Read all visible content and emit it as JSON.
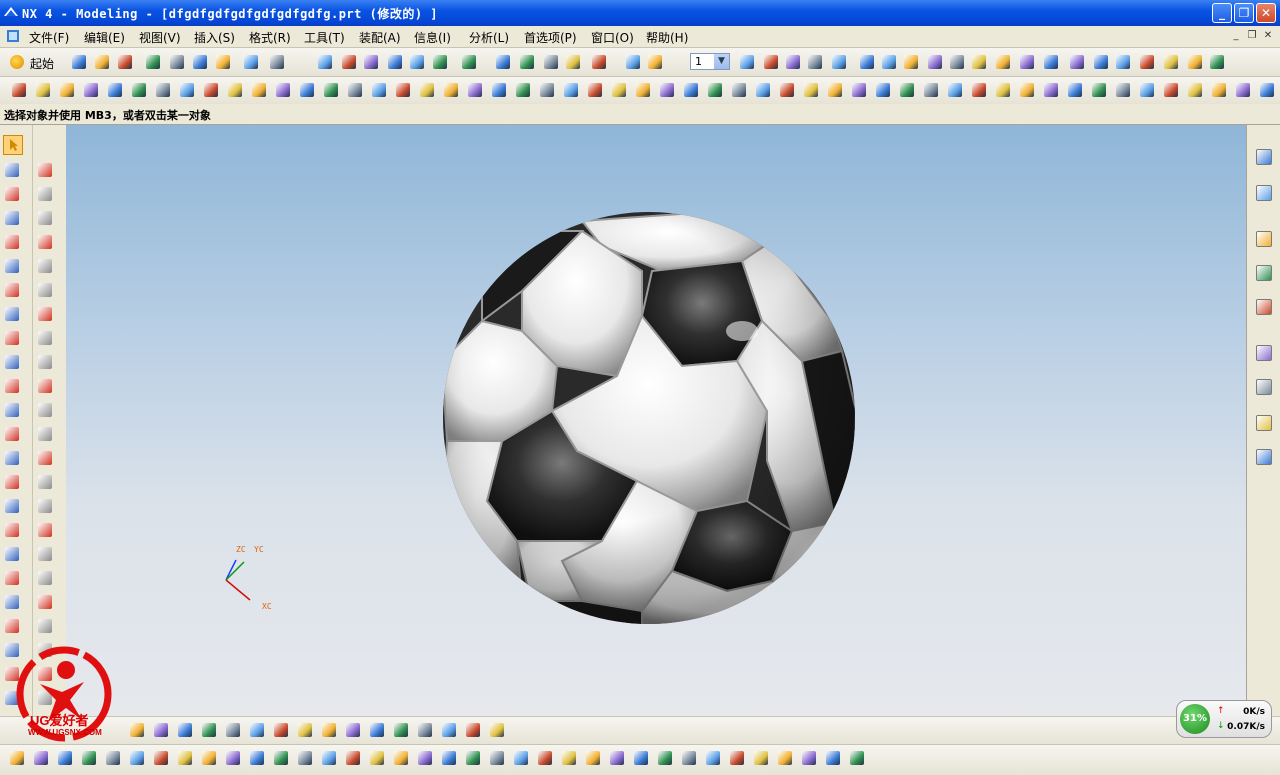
{
  "window": {
    "title": "NX 4 - Modeling - [dfgdfgdfgdfgdfgdfgdfg.prt  (修改的) ]",
    "controls": {
      "minimize": "_",
      "maximize": "❐",
      "close": "✕"
    }
  },
  "menu": {
    "items": [
      "文件(F)",
      "编辑(E)",
      "视图(V)",
      "插入(S)",
      "格式(R)",
      "工具(T)",
      "装配(A)",
      "信息(I)",
      "分析(L)",
      "首选项(P)",
      "窗口(O)",
      "帮助(H)"
    ],
    "doc_controls": {
      "minimize": "_",
      "restore": "❐",
      "close": "✕"
    }
  },
  "toolbar": {
    "start_label": "起始",
    "layer_value": "1"
  },
  "status": {
    "prompt": "选择对象并使用 MB3，或者双击某一对象"
  },
  "viewport": {
    "triad_labels": {
      "zc": "ZC",
      "yc": "YC",
      "xc": "XC"
    }
  },
  "network_widget": {
    "percent": "31%",
    "upload": "0K/s",
    "download": "0.07K/s",
    "up_arrow": "↑",
    "down_arrow": "↓"
  },
  "watermark": {
    "brand": "UG爱好者",
    "url": "WWW.UGSNX.COM"
  },
  "colors": {
    "titlebar": "#0a54e3",
    "viewport_top": "#8fb6d8",
    "viewport_bottom": "#e6e8ec",
    "accent_orange": "#e06000"
  }
}
